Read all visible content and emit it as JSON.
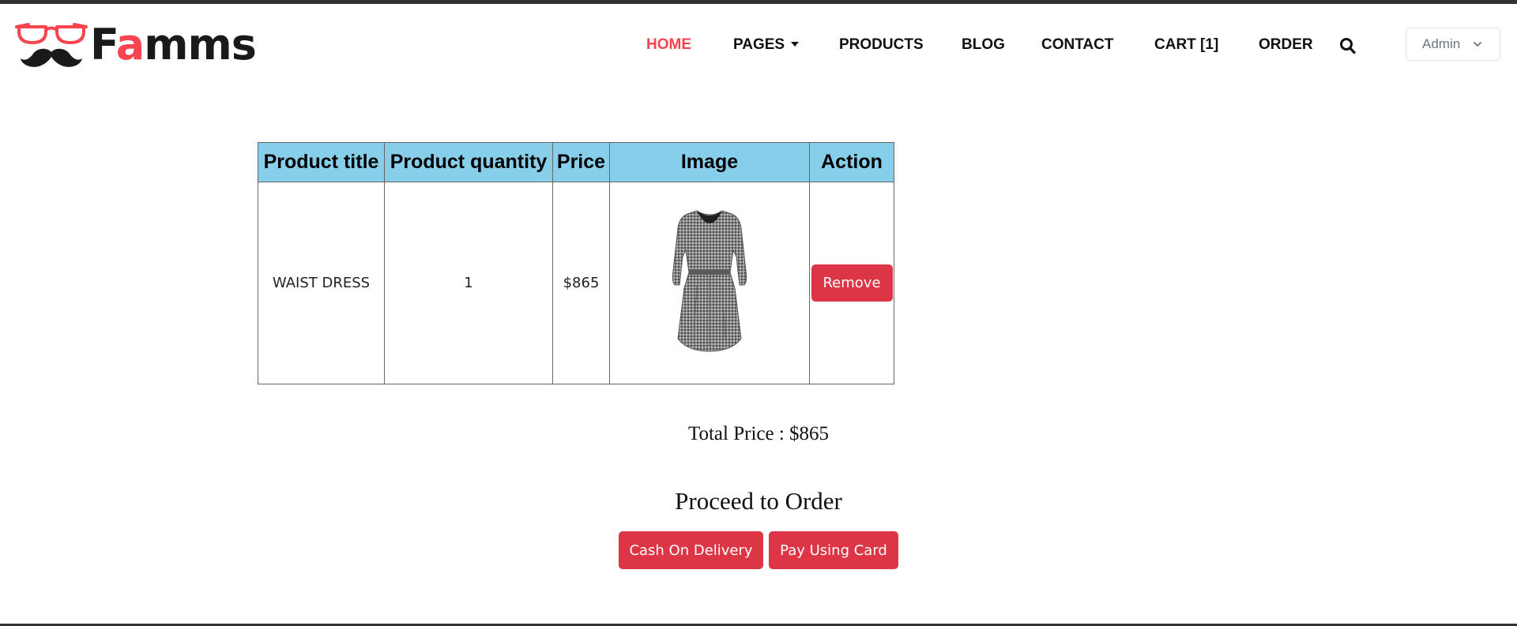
{
  "brand": {
    "prefix": "F",
    "accent": "a",
    "suffix": "mms",
    "accent_color": "#f7444e"
  },
  "nav": {
    "items": [
      {
        "label": "HOME",
        "active": true
      },
      {
        "label": "PAGES",
        "dropdown": true
      },
      {
        "label": "PRODUCTS"
      },
      {
        "label": "BLOG"
      },
      {
        "label": "CONTACT"
      },
      {
        "label": "CART [1]"
      },
      {
        "label": "ORDER"
      }
    ],
    "search_icon": "search-icon"
  },
  "user_menu": {
    "label": "Admin",
    "icon": "chevron-down-icon"
  },
  "cart_table": {
    "headers": [
      "Product title",
      "Product quantity",
      "Price",
      "Image",
      "Action"
    ],
    "header_color": "#87ceeb",
    "rows": [
      {
        "title": "WAIST DRESS",
        "quantity": "1",
        "price": "$865",
        "image": "dress-image",
        "action": "Remove"
      }
    ]
  },
  "summary": {
    "total_text": "Total Price : $865"
  },
  "checkout": {
    "heading": "Proceed to Order",
    "cash_label": "Cash On Delivery",
    "card_label": "Pay Using Card",
    "button_color": "#dc3545"
  }
}
